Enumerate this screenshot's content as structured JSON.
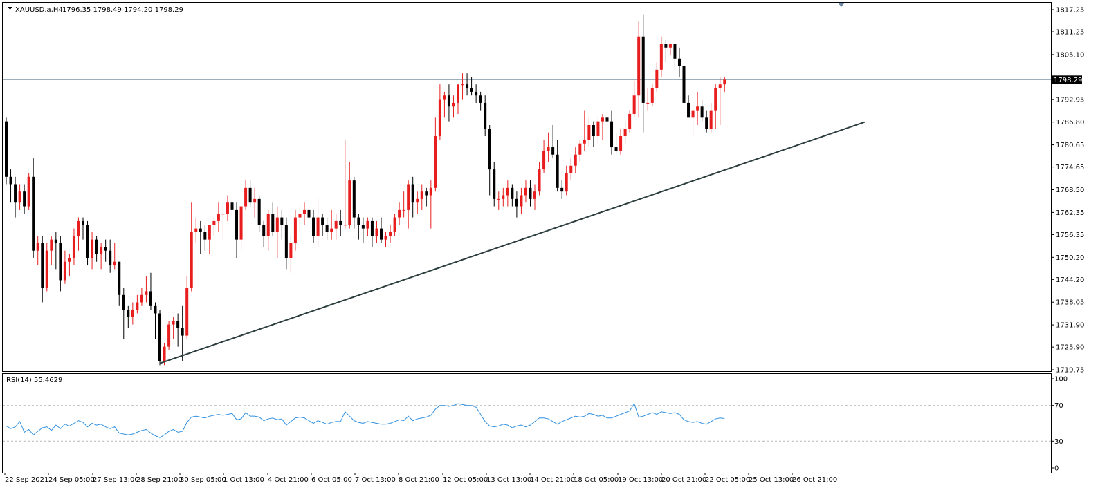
{
  "header": {
    "symbol": "XAUUSD.a,H4",
    "ohlc": "1796.35 1798.49 1794.20 1798.29",
    "rsi_label": "RSI(14) 55.4629"
  },
  "price_tag": "1798.29",
  "colors": {
    "bull": "#e81e1e",
    "bear": "#000000",
    "rsi_line": "#2f8fe0",
    "trendline": "#2b3d3d",
    "price_line": "#8fa3b3"
  },
  "chart_data": [
    {
      "type": "candlestick",
      "title": "XAUUSD.a,H4",
      "ylim": [
        1719.75,
        1817.25
      ],
      "y_ticks": [
        "1817.25",
        "1811.25",
        "1805.10",
        "1798.29",
        "1792.95",
        "1786.80",
        "1780.65",
        "1774.65",
        "1768.50",
        "1762.35",
        "1756.35",
        "1750.20",
        "1744.20",
        "1738.05",
        "1731.90",
        "1725.90",
        "1719.75"
      ],
      "x_ticks": [
        "22 Sep 2021",
        "24 Sep 05:00",
        "27 Sep 13:00",
        "28 Sep 21:00",
        "30 Sep 05:00",
        "1 Oct 13:00",
        "4 Oct 21:00",
        "6 Oct 05:00",
        "7 Oct 13:00",
        "8 Oct 21:00",
        "12 Oct 05:00",
        "13 Oct 13:00",
        "14 Oct 21:00",
        "18 Oct 05:00",
        "19 Oct 13:00",
        "20 Oct 21:00",
        "22 Oct 05:00",
        "25 Oct 13:00",
        "26 Oct 21:00"
      ],
      "current_price": 1798.29,
      "trendline": {
        "from_index": 34,
        "from_price": 1721.5,
        "to_index": 190,
        "to_price": 1786.8
      },
      "ohlc": [
        [
          1787,
          1788,
          1770,
          1772
        ],
        [
          1772,
          1774,
          1765,
          1770
        ],
        [
          1770,
          1772,
          1761,
          1765
        ],
        [
          1765,
          1770,
          1763,
          1768
        ],
        [
          1768,
          1770,
          1762,
          1764
        ],
        [
          1764,
          1773,
          1763,
          1772
        ],
        [
          1772,
          1777,
          1750,
          1752
        ],
        [
          1752,
          1756,
          1748,
          1754
        ],
        [
          1754,
          1756,
          1738,
          1742
        ],
        [
          1742,
          1754,
          1741,
          1752
        ],
        [
          1752,
          1756,
          1748,
          1755
        ],
        [
          1755,
          1757,
          1747,
          1754
        ],
        [
          1754,
          1756,
          1741,
          1744
        ],
        [
          1744,
          1752,
          1743,
          1749
        ],
        [
          1749,
          1751,
          1745,
          1750
        ],
        [
          1750,
          1758,
          1748,
          1756
        ],
        [
          1756,
          1761,
          1752,
          1760
        ],
        [
          1760,
          1761,
          1755,
          1759
        ],
        [
          1759,
          1760,
          1748,
          1750
        ],
        [
          1750,
          1757,
          1747,
          1755
        ],
        [
          1755,
          1756,
          1749,
          1751
        ],
        [
          1751,
          1754,
          1747,
          1753
        ],
        [
          1753,
          1755,
          1749,
          1752
        ],
        [
          1752,
          1755,
          1746,
          1748
        ],
        [
          1748,
          1754,
          1747,
          1749
        ],
        [
          1749,
          1749,
          1737,
          1740
        ],
        [
          1740,
          1742,
          1728,
          1736
        ],
        [
          1736,
          1737,
          1731,
          1734
        ],
        [
          1734,
          1738,
          1732,
          1736
        ],
        [
          1736,
          1740,
          1735,
          1738
        ],
        [
          1738,
          1742,
          1737,
          1740
        ],
        [
          1740,
          1745,
          1738,
          1741
        ],
        [
          1741,
          1746,
          1736,
          1737
        ],
        [
          1737,
          1738,
          1728,
          1735
        ],
        [
          1735,
          1736,
          1721,
          1722
        ],
        [
          1722,
          1727,
          1721,
          1726
        ],
        [
          1726,
          1733,
          1725,
          1732
        ],
        [
          1732,
          1734,
          1728,
          1733
        ],
        [
          1733,
          1735,
          1726,
          1731
        ],
        [
          1731,
          1737,
          1722,
          1729
        ],
        [
          1729,
          1745,
          1728,
          1742
        ],
        [
          1742,
          1765,
          1741,
          1757
        ],
        [
          1757,
          1761,
          1754,
          1758
        ],
        [
          1758,
          1760,
          1751,
          1757
        ],
        [
          1757,
          1759,
          1752,
          1755
        ],
        [
          1755,
          1759,
          1751,
          1759
        ],
        [
          1759,
          1761,
          1756,
          1760
        ],
        [
          1760,
          1765,
          1757,
          1762
        ],
        [
          1762,
          1764,
          1755,
          1762
        ],
        [
          1762,
          1767,
          1760,
          1765
        ],
        [
          1765,
          1766,
          1752,
          1763
        ],
        [
          1763,
          1765,
          1750,
          1755
        ],
        [
          1755,
          1764,
          1752,
          1764
        ],
        [
          1764,
          1771,
          1763,
          1769
        ],
        [
          1769,
          1771,
          1764,
          1765
        ],
        [
          1765,
          1769,
          1761,
          1766
        ],
        [
          1766,
          1767,
          1757,
          1759
        ],
        [
          1759,
          1760,
          1753,
          1756
        ],
        [
          1756,
          1763,
          1752,
          1762
        ],
        [
          1762,
          1765,
          1756,
          1757
        ],
        [
          1757,
          1764,
          1750,
          1761
        ],
        [
          1761,
          1763,
          1755,
          1759
        ],
        [
          1759,
          1761,
          1747,
          1750
        ],
        [
          1750,
          1756,
          1746,
          1754
        ],
        [
          1754,
          1763,
          1752,
          1761
        ],
        [
          1761,
          1764,
          1757,
          1762
        ],
        [
          1762,
          1765,
          1759,
          1763
        ],
        [
          1763,
          1766,
          1757,
          1761
        ],
        [
          1761,
          1763,
          1754,
          1756
        ],
        [
          1756,
          1766,
          1753,
          1761
        ],
        [
          1761,
          1762,
          1756,
          1759
        ],
        [
          1759,
          1761,
          1755,
          1757
        ],
        [
          1757,
          1763,
          1755,
          1758
        ],
        [
          1758,
          1762,
          1755,
          1760
        ],
        [
          1760,
          1763,
          1756,
          1759
        ],
        [
          1759,
          1782,
          1758,
          1759
        ],
        [
          1759,
          1776,
          1758,
          1771
        ],
        [
          1771,
          1772,
          1758,
          1761
        ],
        [
          1761,
          1762,
          1755,
          1759
        ],
        [
          1759,
          1761,
          1754,
          1758
        ],
        [
          1758,
          1761,
          1756,
          1760
        ],
        [
          1760,
          1761,
          1753,
          1756
        ],
        [
          1756,
          1760,
          1754,
          1758
        ],
        [
          1758,
          1761,
          1754,
          1755
        ],
        [
          1755,
          1757,
          1753,
          1756
        ],
        [
          1756,
          1759,
          1754,
          1757
        ],
        [
          1757,
          1762,
          1756,
          1761
        ],
        [
          1761,
          1765,
          1759,
          1763
        ],
        [
          1763,
          1768,
          1761,
          1763
        ],
        [
          1763,
          1771,
          1758,
          1770
        ],
        [
          1770,
          1772,
          1761,
          1765
        ],
        [
          1765,
          1768,
          1762,
          1766
        ],
        [
          1766,
          1770,
          1763,
          1768
        ],
        [
          1768,
          1769,
          1764,
          1767
        ],
        [
          1767,
          1771,
          1758,
          1769
        ],
        [
          1769,
          1788,
          1768,
          1783
        ],
        [
          1783,
          1797,
          1782,
          1793
        ],
        [
          1793,
          1795,
          1788,
          1794
        ],
        [
          1794,
          1797,
          1787,
          1791
        ],
        [
          1791,
          1794,
          1788,
          1792
        ],
        [
          1792,
          1796,
          1789,
          1797
        ],
        [
          1797,
          1800,
          1793,
          1797
        ],
        [
          1797,
          1800,
          1794,
          1796
        ],
        [
          1796,
          1799,
          1794,
          1795
        ],
        [
          1795,
          1797,
          1792,
          1794
        ],
        [
          1794,
          1795,
          1790,
          1792
        ],
        [
          1792,
          1794,
          1783,
          1785
        ],
        [
          1785,
          1786,
          1767,
          1774
        ],
        [
          1774,
          1776,
          1764,
          1766
        ],
        [
          1766,
          1768,
          1763,
          1766
        ],
        [
          1766,
          1769,
          1764,
          1767
        ],
        [
          1767,
          1771,
          1764,
          1769
        ],
        [
          1769,
          1770,
          1764,
          1766
        ],
        [
          1766,
          1768,
          1761,
          1764
        ],
        [
          1764,
          1769,
          1762,
          1767
        ],
        [
          1767,
          1771,
          1765,
          1769
        ],
        [
          1769,
          1771,
          1764,
          1766
        ],
        [
          1766,
          1770,
          1763,
          1768
        ],
        [
          1768,
          1776,
          1767,
          1774
        ],
        [
          1774,
          1782,
          1773,
          1779
        ],
        [
          1779,
          1784,
          1776,
          1780
        ],
        [
          1780,
          1786,
          1777,
          1778
        ],
        [
          1778,
          1782,
          1768,
          1769
        ],
        [
          1769,
          1771,
          1766,
          1768
        ],
        [
          1768,
          1775,
          1767,
          1773
        ],
        [
          1773,
          1777,
          1771,
          1775
        ],
        [
          1775,
          1780,
          1773,
          1778
        ],
        [
          1778,
          1782,
          1776,
          1781
        ],
        [
          1781,
          1790,
          1779,
          1782
        ],
        [
          1782,
          1788,
          1780,
          1786
        ],
        [
          1786,
          1787,
          1780,
          1783
        ],
        [
          1783,
          1788,
          1781,
          1787
        ],
        [
          1787,
          1789,
          1782,
          1788
        ],
        [
          1788,
          1791,
          1784,
          1787
        ],
        [
          1787,
          1790,
          1778,
          1780
        ],
        [
          1780,
          1784,
          1778,
          1779
        ],
        [
          1779,
          1785,
          1778,
          1783
        ],
        [
          1783,
          1787,
          1781,
          1785
        ],
        [
          1785,
          1790,
          1784,
          1789
        ],
        [
          1789,
          1798,
          1788,
          1794
        ],
        [
          1794,
          1814,
          1788,
          1810
        ],
        [
          1810,
          1816,
          1784,
          1792
        ],
        [
          1792,
          1796,
          1790,
          1792
        ],
        [
          1792,
          1797,
          1791,
          1796
        ],
        [
          1796,
          1803,
          1795,
          1801
        ],
        [
          1801,
          1810,
          1799,
          1808
        ],
        [
          1808,
          1809,
          1803,
          1807
        ],
        [
          1807,
          1808,
          1805,
          1808
        ],
        [
          1808,
          1808,
          1801,
          1804
        ],
        [
          1804,
          1807,
          1799,
          1802
        ],
        [
          1802,
          1804,
          1796,
          1792
        ],
        [
          1792,
          1794,
          1788,
          1788
        ],
        [
          1788,
          1792,
          1783,
          1790
        ],
        [
          1790,
          1795,
          1786,
          1791
        ],
        [
          1791,
          1793,
          1787,
          1788
        ],
        [
          1788,
          1790,
          1784,
          1785
        ],
        [
          1785,
          1792,
          1784,
          1790
        ],
        [
          1790,
          1797,
          1785,
          1796
        ],
        [
          1796,
          1799,
          1786,
          1797
        ],
        [
          1797,
          1799,
          1795,
          1798.29
        ]
      ]
    },
    {
      "type": "line",
      "title": "RSI(14) 55.4629",
      "ylim": [
        0,
        100
      ],
      "y_ticks": [
        "100",
        "70",
        "30",
        "0"
      ],
      "levels": [
        70,
        30
      ],
      "series": [
        {
          "name": "RSI(14)",
          "values": [
            47,
            44,
            46,
            52,
            40,
            43,
            37,
            41,
            45,
            46,
            42,
            48,
            44,
            49,
            47,
            50,
            53,
            51,
            46,
            50,
            48,
            49,
            46,
            44,
            46,
            39,
            38,
            37,
            38,
            40,
            42,
            43,
            39,
            36,
            34,
            37,
            41,
            43,
            40,
            41,
            51,
            57,
            58,
            57,
            56,
            58,
            59,
            60,
            59,
            60,
            61,
            54,
            55,
            62,
            58,
            58,
            57,
            53,
            55,
            56,
            54,
            55,
            48,
            52,
            56,
            57,
            56,
            53,
            50,
            53,
            51,
            49,
            51,
            52,
            52,
            63,
            58,
            53,
            51,
            50,
            52,
            51,
            50,
            49,
            49,
            50,
            52,
            54,
            53,
            58,
            53,
            55,
            56,
            57,
            59,
            66,
            70,
            70,
            69,
            70,
            72,
            71,
            70,
            70,
            68,
            60,
            52,
            47,
            46,
            47,
            49,
            48,
            45,
            47,
            48,
            46,
            48,
            52,
            56,
            56,
            55,
            52,
            49,
            52,
            54,
            56,
            58,
            57,
            58,
            61,
            60,
            58,
            59,
            56,
            56,
            58,
            60,
            62,
            64,
            72,
            57,
            58,
            60,
            62,
            60,
            63,
            62,
            61,
            62,
            60,
            54,
            52,
            51,
            52,
            50,
            49,
            52,
            55,
            56,
            55.46
          ]
        }
      ]
    }
  ]
}
